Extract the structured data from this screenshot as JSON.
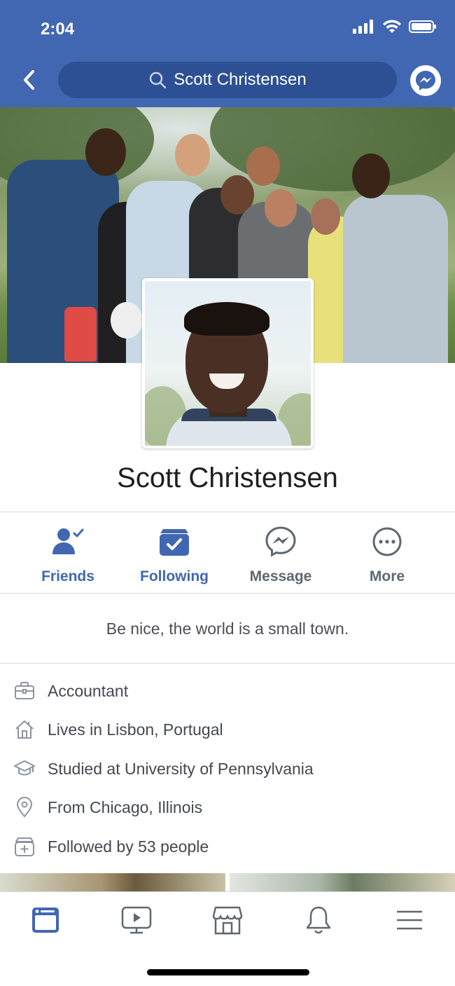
{
  "status_bar": {
    "time": "2:04",
    "icons": [
      "signal-icon",
      "wifi-icon",
      "battery-icon"
    ]
  },
  "header": {
    "search_text": "Scott Christensen",
    "back_icon": "chevron-left-icon",
    "messenger_icon": "messenger-icon"
  },
  "profile": {
    "name": "Scott Christensen",
    "bio": "Be nice, the world is a small town."
  },
  "actions": [
    {
      "label": "Friends",
      "icon": "friends-check-icon",
      "active": true
    },
    {
      "label": "Following",
      "icon": "following-check-icon",
      "active": true
    },
    {
      "label": "Message",
      "icon": "messenger-outline-icon",
      "active": false
    },
    {
      "label": "More",
      "icon": "more-dots-icon",
      "active": false
    }
  ],
  "intro": [
    {
      "text": "Accountant",
      "icon": "briefcase-icon"
    },
    {
      "text": "Lives in Lisbon, Portugal",
      "icon": "home-icon"
    },
    {
      "text": "Studied at University of Pennsylvania",
      "icon": "graduation-cap-icon"
    },
    {
      "text": "From Chicago, Illinois",
      "icon": "location-pin-icon"
    },
    {
      "text": "Followed by 53 people",
      "icon": "followers-icon"
    }
  ],
  "tabbar": [
    {
      "name": "news-feed",
      "icon": "news-feed-icon",
      "active": true
    },
    {
      "name": "watch",
      "icon": "watch-icon",
      "active": false
    },
    {
      "name": "marketplace",
      "icon": "marketplace-icon",
      "active": false
    },
    {
      "name": "notifications",
      "icon": "bell-icon",
      "active": false
    },
    {
      "name": "menu",
      "icon": "menu-icon",
      "active": false
    }
  ],
  "colors": {
    "brand": "#4267b2",
    "search_bg": "#2d4f94",
    "text_gray": "#606770"
  }
}
